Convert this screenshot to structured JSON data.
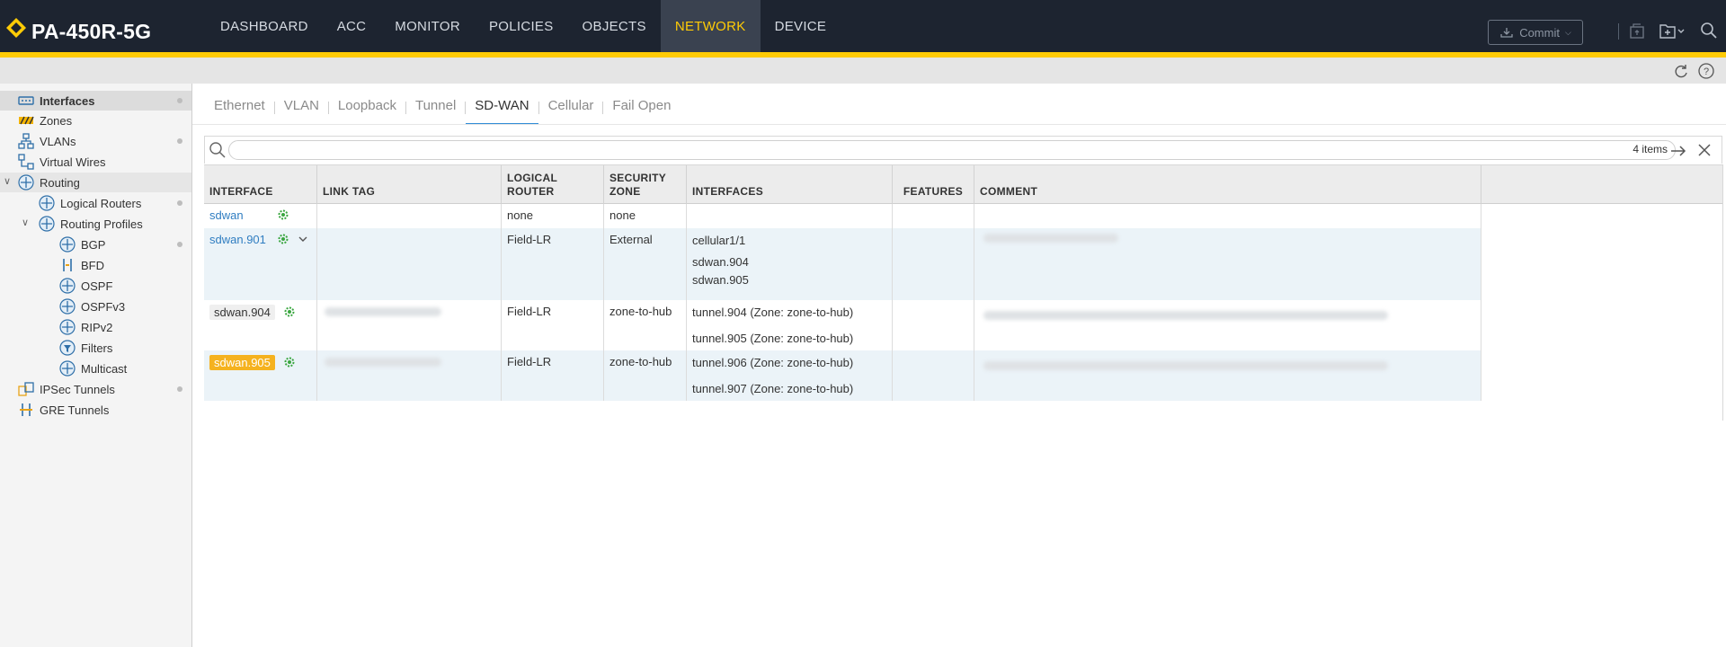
{
  "header": {
    "model": "PA-450R-5G",
    "nav": [
      {
        "label": "DASHBOARD"
      },
      {
        "label": "ACC"
      },
      {
        "label": "MONITOR"
      },
      {
        "label": "POLICIES"
      },
      {
        "label": "OBJECTS"
      },
      {
        "label": "NETWORK",
        "active": true
      },
      {
        "label": "DEVICE"
      }
    ],
    "commit_label": "Commit",
    "accent_color": "#ffcb06"
  },
  "sidebar": {
    "items": [
      {
        "label": "Interfaces",
        "icon": "interfaces-icon"
      },
      {
        "label": "Zones",
        "icon": "zones-icon"
      },
      {
        "label": "VLANs",
        "icon": "vlans-icon"
      },
      {
        "label": "Virtual Wires",
        "icon": "virtual-wires-icon"
      },
      {
        "label": "Routing",
        "icon": "routing-icon"
      },
      {
        "label": "Logical Routers",
        "icon": "routing-icon"
      },
      {
        "label": "Routing Profiles",
        "icon": "routing-icon"
      },
      {
        "label": "BGP",
        "icon": "routing-icon"
      },
      {
        "label": "BFD",
        "icon": "bfd-icon"
      },
      {
        "label": "OSPF",
        "icon": "routing-icon"
      },
      {
        "label": "OSPFv3",
        "icon": "routing-icon"
      },
      {
        "label": "RIPv2",
        "icon": "routing-icon"
      },
      {
        "label": "Filters",
        "icon": "filter-icon"
      },
      {
        "label": "Multicast",
        "icon": "routing-icon"
      },
      {
        "label": "IPSec Tunnels",
        "icon": "ipsec-icon"
      },
      {
        "label": "GRE Tunnels",
        "icon": "gre-icon"
      }
    ]
  },
  "tabs": [
    {
      "label": "Ethernet"
    },
    {
      "label": "VLAN"
    },
    {
      "label": "Loopback"
    },
    {
      "label": "Tunnel"
    },
    {
      "label": "SD-WAN",
      "active": true
    },
    {
      "label": "Cellular"
    },
    {
      "label": "Fail Open"
    }
  ],
  "search": {
    "placeholder": "",
    "items_count": "4 items"
  },
  "table": {
    "headers": {
      "interface": "INTERFACE",
      "link_tag": "LINK TAG",
      "logical_router_1": "LOGICAL",
      "logical_router_2": "ROUTER",
      "security_zone_1": "SECURITY",
      "security_zone_2": "ZONE",
      "interfaces": "INTERFACES",
      "features": "FEATURES",
      "comment": "COMMENT"
    },
    "rows": [
      {
        "interface": "sdwan",
        "logical_router": "none",
        "security_zone": "none",
        "interfaces": []
      },
      {
        "interface": "sdwan.901",
        "logical_router": "Field-LR",
        "security_zone": "External",
        "interfaces": [
          "cellular1/1",
          "sdwan.904",
          "sdwan.905"
        ]
      },
      {
        "interface": "sdwan.904",
        "logical_router": "Field-LR",
        "security_zone": "zone-to-hub",
        "interfaces": [
          "tunnel.904 (Zone: zone-to-hub)",
          "tunnel.905 (Zone: zone-to-hub)"
        ]
      },
      {
        "interface": "sdwan.905",
        "logical_router": "Field-LR",
        "security_zone": "zone-to-hub",
        "interfaces": [
          "tunnel.906 (Zone: zone-to-hub)",
          "tunnel.907 (Zone: zone-to-hub)"
        ]
      }
    ]
  }
}
